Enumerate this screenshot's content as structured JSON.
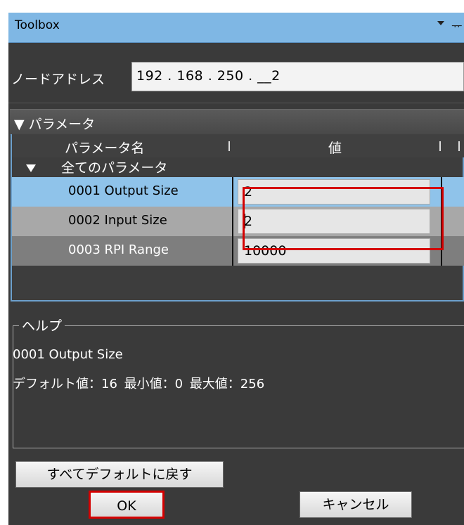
{
  "window": {
    "title": "Toolbox",
    "menu_icon": "dropdown-arrow-icon",
    "pin_glyph": "ᅲ",
    "pin_icon": "pin-icon"
  },
  "node_address": {
    "label": "ノードアドレス",
    "value": "192 . 168 . 250 . __2"
  },
  "parameters": {
    "section_title": "▼ パラメータ",
    "columns": [
      "パラメータ名",
      "値"
    ],
    "group_label": "全てのパラメータ",
    "rows": [
      {
        "name": "0001 Output Size",
        "value": "2"
      },
      {
        "name": "0002 Input Size",
        "value": "2"
      },
      {
        "name": "0003 RPI Range",
        "value": "10000"
      }
    ]
  },
  "help": {
    "title": "ヘルプ",
    "selected_param": "0001 Output Size",
    "details": "デフォルト値：16 最小値：0 最大値：256"
  },
  "buttons": {
    "reset_defaults": "すべてデフォルトに戻す",
    "ok": "OK",
    "cancel": "キャンセル"
  },
  "colors": {
    "title_bar": "#7fb7e4",
    "panel_bg": "#3a3a3a",
    "selected_row": "#8fc3ea",
    "highlight": "#d40000"
  }
}
